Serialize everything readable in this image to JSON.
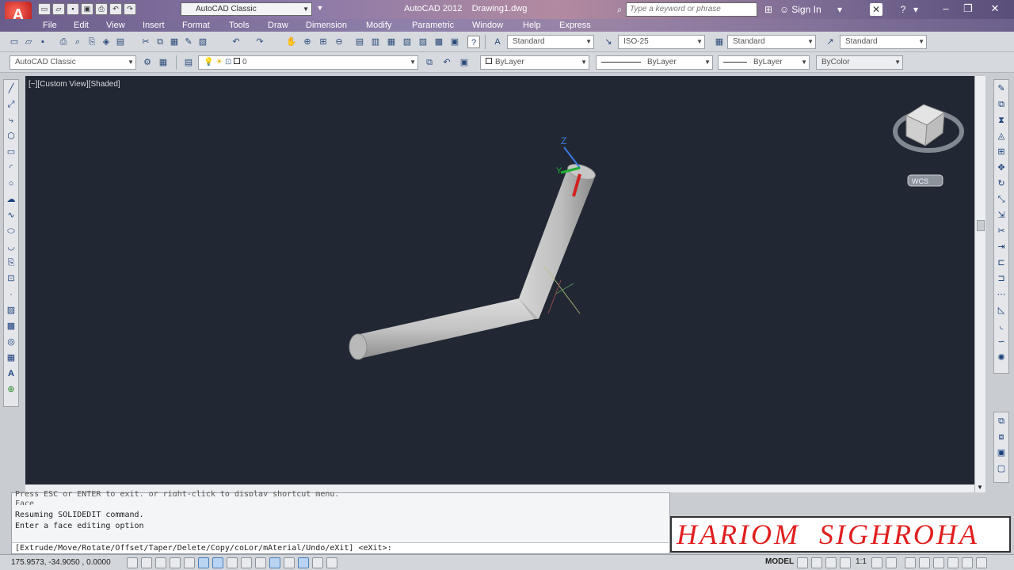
{
  "titlebar": {
    "app_title": "AutoCAD 2012",
    "drawing_name": "Drawing1.dwg",
    "workspace": "AutoCAD Classic",
    "search_placeholder": "Type a keyword or phrase",
    "signin": "Sign In"
  },
  "menu": {
    "items": [
      "File",
      "Edit",
      "View",
      "Insert",
      "Format",
      "Tools",
      "Draw",
      "Dimension",
      "Modify",
      "Parametric",
      "Window",
      "Help",
      "Express"
    ]
  },
  "styles_toolbar": {
    "text_style": "Standard",
    "dim_style": "ISO-25",
    "table_style": "Standard",
    "multileader_style": "Standard"
  },
  "workspace_toolbar": {
    "workspace": "AutoCAD Classic",
    "layer": "0"
  },
  "properties_toolbar": {
    "color": "ByLayer",
    "linetype": "ByLayer",
    "lineweight": "ByLayer",
    "plot_style": "ByColor"
  },
  "viewport": {
    "label": "[−][Custom View][Shaded]",
    "wcs_label": "WCS",
    "axis_z": "Z",
    "axis_y": "Y"
  },
  "command": {
    "line1": "Press ESC or ENTER to exit, or right-click to display shortcut menu.",
    "line2": "Face",
    "line3": "Resuming SOLIDEDIT command.",
    "line4": "Enter a face editing option",
    "prompt": "[Extrude/Move/Rotate/Offset/Taper/Delete/Copy/coLor/mAterial/Undo/eXit] <eXit>:"
  },
  "watermark": "HARIOM  SIGHROHA",
  "status": {
    "coords": "175.9573, -34.9050 , 0.0000",
    "model": "MODEL",
    "annotation_scale": "1:1"
  },
  "colors": {
    "viewport_bg": "#212833",
    "solid_fill": "#c9c9c9",
    "watermark_text": "#e01e1e",
    "ucs_z": "#3a7be0",
    "ucs_x": "#d02020",
    "ucs_y": "#20b030"
  }
}
